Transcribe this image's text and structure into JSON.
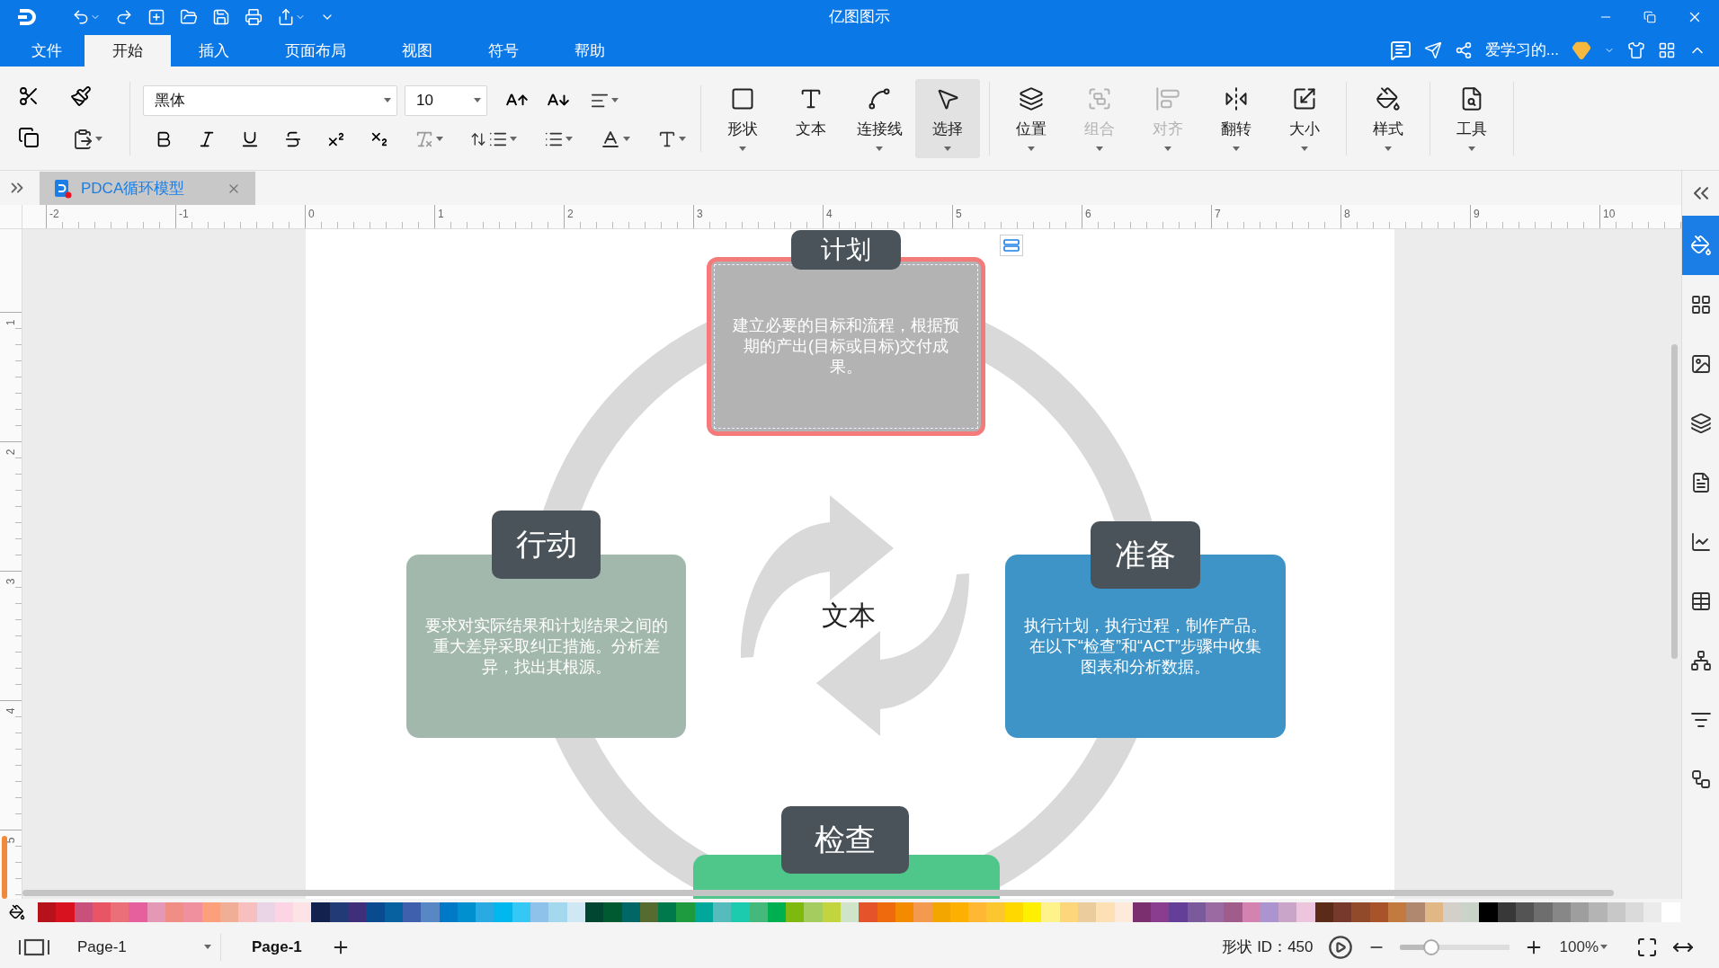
{
  "window": {
    "title": "亿图图示"
  },
  "menu_tabs": [
    {
      "label": "文件",
      "selected": false
    },
    {
      "label": "开始",
      "selected": true
    },
    {
      "label": "插入",
      "selected": false
    },
    {
      "label": "页面布局",
      "selected": false
    },
    {
      "label": "视图",
      "selected": false
    },
    {
      "label": "符号",
      "selected": false
    },
    {
      "label": "帮助",
      "selected": false
    }
  ],
  "account": {
    "user": "爱学习的..."
  },
  "toolbar": {
    "font": "黑体",
    "font_size": "10",
    "tools": [
      {
        "kind": "shape",
        "label": "形状",
        "selected": false,
        "disabled": false,
        "dropdown": true
      },
      {
        "kind": "text",
        "label": "文本",
        "selected": false,
        "disabled": false,
        "dropdown": false
      },
      {
        "kind": "connector",
        "label": "连接线",
        "selected": false,
        "disabled": false,
        "dropdown": true
      },
      {
        "kind": "select",
        "label": "选择",
        "selected": true,
        "disabled": false,
        "dropdown": true
      },
      {
        "kind": "position",
        "label": "位置",
        "selected": false,
        "disabled": false,
        "dropdown": true
      },
      {
        "kind": "group",
        "label": "组合",
        "selected": false,
        "disabled": true,
        "dropdown": true
      },
      {
        "kind": "align",
        "label": "对齐",
        "selected": false,
        "disabled": true,
        "dropdown": true
      },
      {
        "kind": "flip",
        "label": "翻转",
        "selected": false,
        "disabled": false,
        "dropdown": true
      },
      {
        "kind": "size",
        "label": "大小",
        "selected": false,
        "disabled": false,
        "dropdown": true
      },
      {
        "kind": "style",
        "label": "样式",
        "selected": false,
        "disabled": false,
        "dropdown": true
      },
      {
        "kind": "tools",
        "label": "工具",
        "selected": false,
        "disabled": false,
        "dropdown": true
      }
    ]
  },
  "document_tabs": [
    {
      "title": "PDCA循环模型",
      "selected": true
    }
  ],
  "ruler": {
    "horizontal": [
      "-2",
      "-1",
      "0",
      "1",
      "2",
      "3",
      "4",
      "5",
      "6",
      "7",
      "8",
      "9",
      "10"
    ],
    "vertical": [
      "1",
      "2",
      "3",
      "4",
      "5"
    ]
  },
  "diagram": {
    "center_text": "文本",
    "stages": [
      {
        "title": "计划",
        "text": "建立必要的目标和流程，根据预期的产出(目标或目标)交付成果。",
        "color": "#b3b3b3",
        "selected": true
      },
      {
        "title": "行动",
        "text": "要求对实际结果和计划结果之间的重大差异采取纠正措施。分析差异，找出其根源。",
        "color": "#a3b8ad",
        "selected": false
      },
      {
        "title": "准备",
        "text": "执行计划，执行过程，制作产品。在以下“检查”和“ACT”步骤中收集图表和分析数据。",
        "color": "#3e93c7",
        "selected": false
      },
      {
        "title": "检查",
        "color": "#4fc68a",
        "selected": false
      }
    ]
  },
  "side_panel": [
    {
      "kind": "fill",
      "selected": true
    },
    {
      "kind": "symbols",
      "selected": false
    },
    {
      "kind": "image",
      "selected": false
    },
    {
      "kind": "layers",
      "selected": false
    },
    {
      "kind": "page",
      "selected": false
    },
    {
      "kind": "chart",
      "selected": false
    },
    {
      "kind": "table",
      "selected": false
    },
    {
      "kind": "org",
      "selected": false
    },
    {
      "kind": "list",
      "selected": false
    },
    {
      "kind": "layout",
      "selected": false
    }
  ],
  "palette": [
    {
      "color": "#b5121b"
    },
    {
      "color": "#d8121f"
    },
    {
      "color": "#c9507a"
    },
    {
      "color": "#e85565"
    },
    {
      "color": "#ea6f79"
    },
    {
      "color": "#e6609e"
    },
    {
      "color": "#e598b6"
    },
    {
      "color": "#f08e86"
    },
    {
      "color": "#f0909f"
    },
    {
      "color": "#fba07a"
    },
    {
      "color": "#f1ae97"
    },
    {
      "color": "#f7bfbd"
    },
    {
      "color": "#ead5e6"
    },
    {
      "color": "#fdd4e3"
    },
    {
      "color": "#fde2e6"
    },
    {
      "color": "#13214f"
    },
    {
      "color": "#223a76"
    },
    {
      "color": "#3f2e7a"
    },
    {
      "color": "#0a4a8f"
    },
    {
      "color": "#07609f"
    },
    {
      "color": "#3e60ad"
    },
    {
      "color": "#5887c5"
    },
    {
      "color": "#0079c6"
    },
    {
      "color": "#0090cf"
    },
    {
      "color": "#2aaae2"
    },
    {
      "color": "#00b7ee"
    },
    {
      "color": "#35c8f5"
    },
    {
      "color": "#8ec2eb"
    },
    {
      "color": "#a4d8ee"
    },
    {
      "color": "#cfe8f3"
    },
    {
      "color": "#004631"
    },
    {
      "color": "#005a31"
    },
    {
      "color": "#006666"
    },
    {
      "color": "#556b2f"
    },
    {
      "color": "#007a4d"
    },
    {
      "color": "#1e9a3f"
    },
    {
      "color": "#00a79b"
    },
    {
      "color": "#55bbbd"
    },
    {
      "color": "#1ccaae"
    },
    {
      "color": "#45b97c"
    },
    {
      "color": "#00b050"
    },
    {
      "color": "#7fb80e"
    },
    {
      "color": "#a5cc5f"
    },
    {
      "color": "#c2d53f"
    },
    {
      "color": "#cfe4c8"
    },
    {
      "color": "#e5532b"
    },
    {
      "color": "#ee6a0d"
    },
    {
      "color": "#f48a00"
    },
    {
      "color": "#f39a4e"
    },
    {
      "color": "#f3a600"
    },
    {
      "color": "#fdb002"
    },
    {
      "color": "#ffb734"
    },
    {
      "color": "#fcc72e"
    },
    {
      "color": "#ffd800"
    },
    {
      "color": "#ffef00"
    },
    {
      "color": "#fef38b"
    },
    {
      "color": "#fdd67b"
    },
    {
      "color": "#ebcc9c"
    },
    {
      "color": "#fde1b5"
    },
    {
      "color": "#fdeadb"
    },
    {
      "color": "#7b2f6f"
    },
    {
      "color": "#8a3d8f"
    },
    {
      "color": "#653e98"
    },
    {
      "color": "#7a5a9a"
    },
    {
      "color": "#9b6aa2"
    },
    {
      "color": "#a05d8c"
    },
    {
      "color": "#d483b1"
    },
    {
      "color": "#ac94cf"
    },
    {
      "color": "#c9a5c9"
    },
    {
      "color": "#edc6dd"
    },
    {
      "color": "#5c2b17"
    },
    {
      "color": "#76392c"
    },
    {
      "color": "#924b2a"
    },
    {
      "color": "#a9532a"
    },
    {
      "color": "#c27a3f"
    },
    {
      "color": "#b08870"
    },
    {
      "color": "#e1b786"
    },
    {
      "color": "#d5cfc9"
    },
    {
      "color": "#c9d3c8"
    },
    {
      "color": "#000000"
    },
    {
      "color": "#383838"
    },
    {
      "color": "#545454"
    },
    {
      "color": "#6e6e6e"
    },
    {
      "color": "#878787"
    },
    {
      "color": "#9e9e9e"
    },
    {
      "color": "#b4b4b4"
    },
    {
      "color": "#c8c8c8"
    },
    {
      "color": "#dadada"
    },
    {
      "color": "#ebebeb"
    },
    {
      "color": "#ffffff"
    }
  ],
  "status_bar": {
    "page_select": "Page-1",
    "pages": [
      {
        "label": "Page-1",
        "selected": true
      }
    ],
    "shape_id": "形状 ID：450",
    "zoom": {
      "level": 0.25
    },
    "zoom_text": "100%"
  }
}
